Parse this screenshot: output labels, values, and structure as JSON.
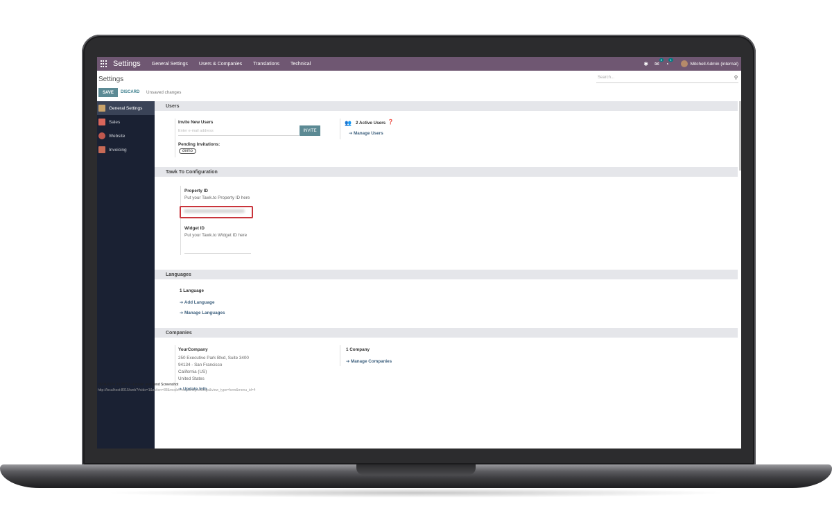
{
  "navbar": {
    "brand": "Settings",
    "menus": [
      "General Settings",
      "Users & Companies",
      "Translations",
      "Technical"
    ],
    "messages_badge": "3",
    "activity_badge": "1",
    "user": "Mitchell Admin (internal)"
  },
  "control_panel": {
    "title": "Settings",
    "search_placeholder": "Search...",
    "save_label": "SAVE",
    "discard_label": "DISCARD",
    "status": "Unsaved changes"
  },
  "sidebar": {
    "items": [
      {
        "label": "General Settings",
        "color": "#c9a36a"
      },
      {
        "label": "Sales",
        "color": "#d9665b"
      },
      {
        "label": "Website",
        "color": "#c0584e"
      },
      {
        "label": "Invoicing",
        "color": "#c76a56"
      }
    ]
  },
  "users": {
    "header": "Users",
    "invite_label": "Invite New Users",
    "email_placeholder": "Enter e-mail address",
    "invite_button": "INVITE",
    "pending_label": "Pending Invitations:",
    "pending_tag": "demo",
    "active_users": "2 Active Users",
    "manage_users": "Manage Users"
  },
  "tawk": {
    "header": "Tawk To Configuration",
    "property_label": "Property ID",
    "property_help": "Put your Tawk.to Property ID here",
    "widget_label": "Widget ID",
    "widget_help": "Put your Tawk.to Widget ID here"
  },
  "languages": {
    "header": "Languages",
    "count": "1 Language",
    "add": "Add Language",
    "manage": "Manage Languages"
  },
  "companies": {
    "header": "Companies",
    "name": "YourCompany",
    "address_1": "250 Executive Park Blvd, Suite 3400",
    "address_2": "94134 - San Francisco",
    "address_3": "California (US)",
    "address_4": "United States",
    "update_info": "Update Info",
    "count": "1 Company",
    "manage": "Manage Companies"
  },
  "debug": {
    "line1": "05/04/2024 09:28:52 • Explain and Send Screenshot",
    "line2": "http://localhost:8015/web?#cids=1&action=88&model=res.config.settings&view_type=form&menu_id=4"
  }
}
